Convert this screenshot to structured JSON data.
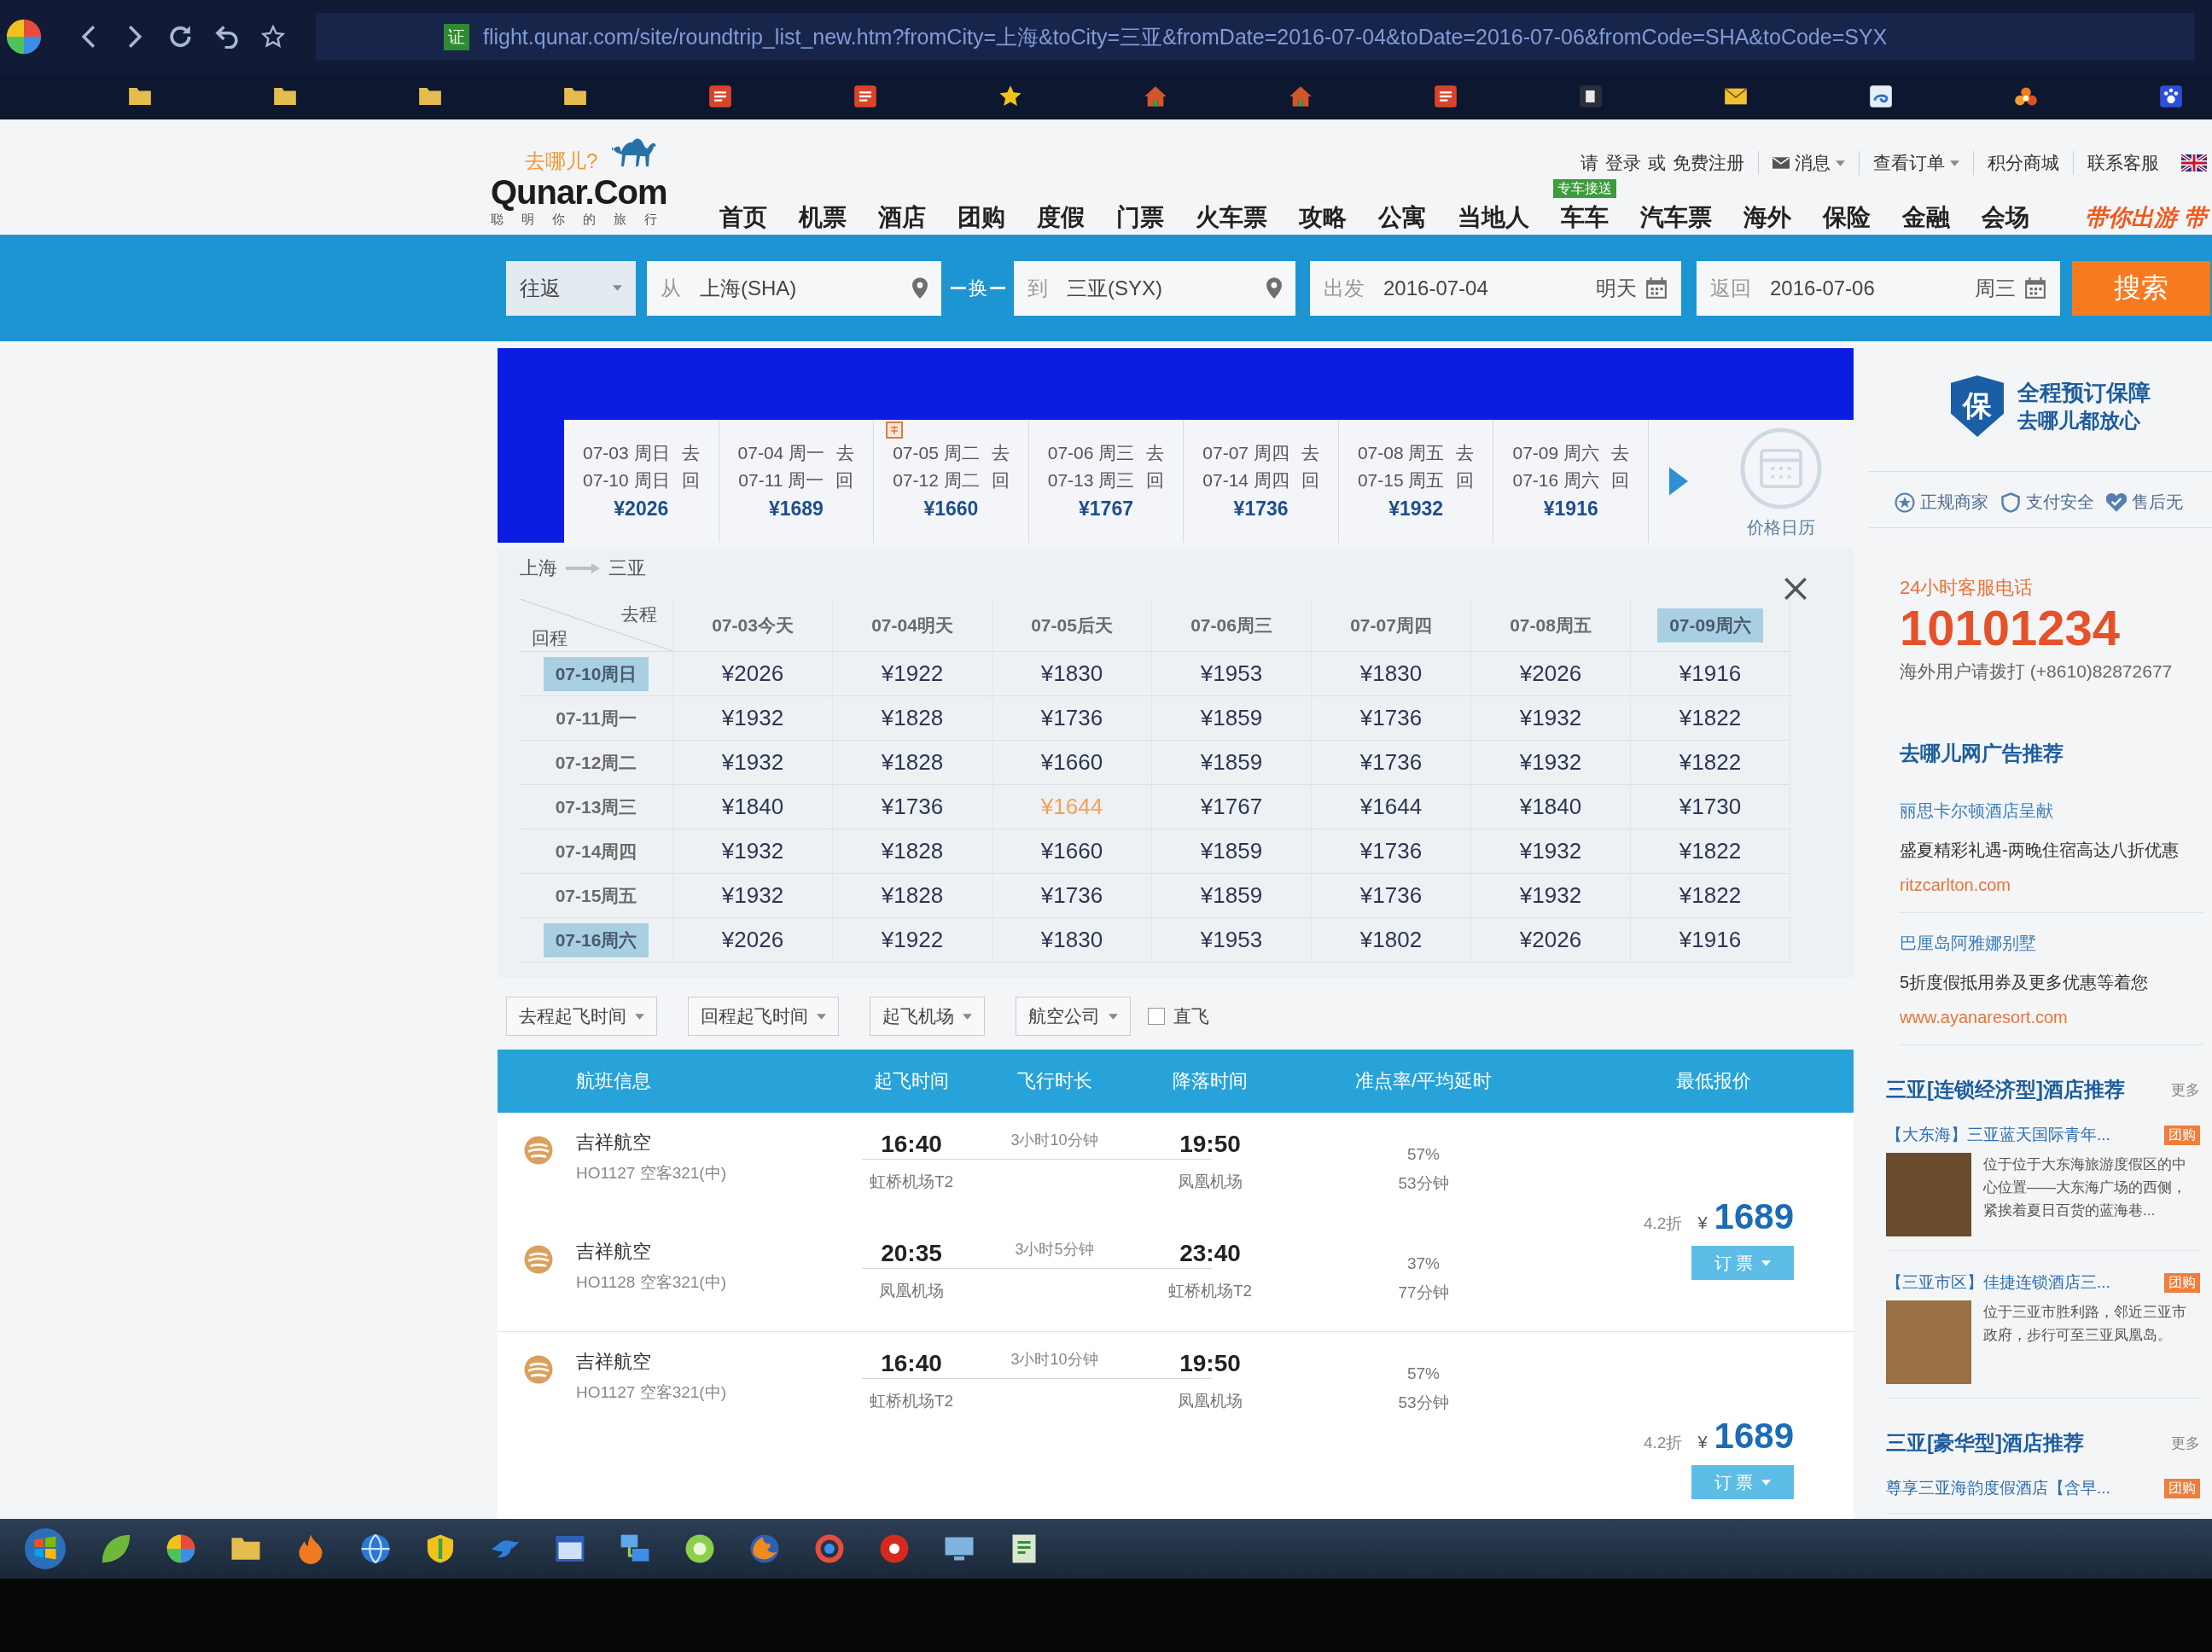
{
  "browser": {
    "cert_badge": "证",
    "url": "flight.qunar.com/site/roundtrip_list_new.htm?fromCity=上海&toCity=三亚&fromDate=2016-07-04&toDate=2016-07-06&fromCode=SHA&toCode=SYX"
  },
  "header": {
    "logo": {
      "kicker": "去哪儿?",
      "wordmark": "Qunar.Com",
      "tagline": "聪明你的旅行"
    },
    "account": {
      "prompt": "请",
      "login": "登录",
      "joiner": "或",
      "register": "免费注册"
    },
    "top_menu": [
      {
        "label": "消息",
        "kind": "messages",
        "dropdown": true
      },
      {
        "label": "查看订单",
        "kind": "orders",
        "dropdown": true
      },
      {
        "label": "积分商城",
        "kind": "mall",
        "dropdown": false
      },
      {
        "label": "联系客服",
        "kind": "service",
        "dropdown": false
      }
    ],
    "nav": [
      {
        "label": "首页"
      },
      {
        "label": "机票"
      },
      {
        "label": "酒店"
      },
      {
        "label": "团购"
      },
      {
        "label": "度假"
      },
      {
        "label": "门票"
      },
      {
        "label": "火车票"
      },
      {
        "label": "攻略"
      },
      {
        "label": "公寓"
      },
      {
        "label": "当地人"
      },
      {
        "label": "车车",
        "badge": "专车接送"
      },
      {
        "label": "汽车票"
      },
      {
        "label": "海外"
      },
      {
        "label": "保险"
      },
      {
        "label": "金融"
      },
      {
        "label": "会场"
      }
    ],
    "slogan": "带你出游 带"
  },
  "search": {
    "trip_type": "往返",
    "from": {
      "label": "从",
      "value": "上海(SHA)"
    },
    "swap": "换",
    "to": {
      "label": "到",
      "value": "三亚(SYX)"
    },
    "depart": {
      "label": "出发",
      "value": "2016-07-04",
      "day": "明天"
    },
    "return": {
      "label": "返回",
      "value": "2016-07-06",
      "day": "周三"
    },
    "button": "搜索"
  },
  "date_strip": {
    "items": [
      {
        "depart": "07-03 周日",
        "depart_tag": "去",
        "return": "07-10 周日",
        "return_tag": "回",
        "price": "¥2026",
        "promo": false
      },
      {
        "depart": "07-04 周一",
        "depart_tag": "去",
        "return": "07-11 周一",
        "return_tag": "回",
        "price": "¥1689",
        "promo": false
      },
      {
        "depart": "07-05 周二",
        "depart_tag": "去",
        "return": "07-12 周二",
        "return_tag": "回",
        "price": "¥1660",
        "promo": true
      },
      {
        "depart": "07-06 周三",
        "depart_tag": "去",
        "return": "07-13 周三",
        "return_tag": "回",
        "price": "¥1767",
        "promo": false
      },
      {
        "depart": "07-07 周四",
        "depart_tag": "去",
        "return": "07-14 周四",
        "return_tag": "回",
        "price": "¥1736",
        "promo": false
      },
      {
        "depart": "07-08 周五",
        "depart_tag": "去",
        "return": "07-15 周五",
        "return_tag": "回",
        "price": "¥1932",
        "promo": false
      },
      {
        "depart": "07-09 周六",
        "depart_tag": "去",
        "return": "07-16 周六",
        "return_tag": "回",
        "price": "¥1916",
        "promo": false
      }
    ],
    "calendar_label": "价格日历"
  },
  "matrix": {
    "origin": "上海",
    "destination": "三亚",
    "corner_depart": "去程",
    "corner_return": "回程",
    "columns": [
      {
        "label": "07-03今天",
        "selected": false
      },
      {
        "label": "07-04明天",
        "selected": false
      },
      {
        "label": "07-05后天",
        "selected": false
      },
      {
        "label": "07-06周三",
        "selected": false
      },
      {
        "label": "07-07周四",
        "selected": false
      },
      {
        "label": "07-08周五",
        "selected": false
      },
      {
        "label": "07-09周六",
        "selected": true
      }
    ],
    "rows": [
      {
        "label": "07-10周日",
        "selected": true,
        "cells": [
          {
            "price": "¥2026",
            "highlighted": false
          },
          {
            "price": "¥1922",
            "highlighted": false
          },
          {
            "price": "¥1830",
            "highlighted": false
          },
          {
            "price": "¥1953",
            "highlighted": false
          },
          {
            "price": "¥1830",
            "highlighted": false
          },
          {
            "price": "¥2026",
            "highlighted": false
          },
          {
            "price": "¥1916",
            "highlighted": false
          }
        ]
      },
      {
        "label": "07-11周一",
        "selected": false,
        "cells": [
          {
            "price": "¥1932",
            "highlighted": false
          },
          {
            "price": "¥1828",
            "highlighted": false
          },
          {
            "price": "¥1736",
            "highlighted": false
          },
          {
            "price": "¥1859",
            "highlighted": false
          },
          {
            "price": "¥1736",
            "highlighted": false
          },
          {
            "price": "¥1932",
            "highlighted": false
          },
          {
            "price": "¥1822",
            "highlighted": false
          }
        ]
      },
      {
        "label": "07-12周二",
        "selected": false,
        "cells": [
          {
            "price": "¥1932",
            "highlighted": false
          },
          {
            "price": "¥1828",
            "highlighted": false
          },
          {
            "price": "¥1660",
            "highlighted": false
          },
          {
            "price": "¥1859",
            "highlighted": false
          },
          {
            "price": "¥1736",
            "highlighted": false
          },
          {
            "price": "¥1932",
            "highlighted": false
          },
          {
            "price": "¥1822",
            "highlighted": false
          }
        ]
      },
      {
        "label": "07-13周三",
        "selected": false,
        "cells": [
          {
            "price": "¥1840",
            "highlighted": false
          },
          {
            "price": "¥1736",
            "highlighted": false
          },
          {
            "price": "¥1644",
            "highlighted": true
          },
          {
            "price": "¥1767",
            "highlighted": false
          },
          {
            "price": "¥1644",
            "highlighted": false
          },
          {
            "price": "¥1840",
            "highlighted": false
          },
          {
            "price": "¥1730",
            "highlighted": false
          }
        ]
      },
      {
        "label": "07-14周四",
        "selected": false,
        "cells": [
          {
            "price": "¥1932",
            "highlighted": false
          },
          {
            "price": "¥1828",
            "highlighted": false
          },
          {
            "price": "¥1660",
            "highlighted": false
          },
          {
            "price": "¥1859",
            "highlighted": false
          },
          {
            "price": "¥1736",
            "highlighted": false
          },
          {
            "price": "¥1932",
            "highlighted": false
          },
          {
            "price": "¥1822",
            "highlighted": false
          }
        ]
      },
      {
        "label": "07-15周五",
        "selected": false,
        "cells": [
          {
            "price": "¥1932",
            "highlighted": false
          },
          {
            "price": "¥1828",
            "highlighted": false
          },
          {
            "price": "¥1736",
            "highlighted": false
          },
          {
            "price": "¥1859",
            "highlighted": false
          },
          {
            "price": "¥1736",
            "highlighted": false
          },
          {
            "price": "¥1932",
            "highlighted": false
          },
          {
            "price": "¥1822",
            "highlighted": false
          }
        ]
      },
      {
        "label": "07-16周六",
        "selected": true,
        "cells": [
          {
            "price": "¥2026",
            "highlighted": false
          },
          {
            "price": "¥1922",
            "highlighted": false
          },
          {
            "price": "¥1830",
            "highlighted": false
          },
          {
            "price": "¥1953",
            "highlighted": false
          },
          {
            "price": "¥1802",
            "highlighted": false
          },
          {
            "price": "¥2026",
            "highlighted": false
          },
          {
            "price": "¥1916",
            "highlighted": false
          }
        ]
      }
    ]
  },
  "filters": {
    "dropdowns": [
      "去程起飞时间",
      "回程起飞时间",
      "起飞机场",
      "航空公司"
    ],
    "nonstop": {
      "label": "直飞",
      "checked": false
    }
  },
  "flights": {
    "columns": [
      "航班信息",
      "起飞时间",
      "飞行时长",
      "降落时间",
      "准点率/平均延时",
      "最低报价"
    ],
    "groups": [
      {
        "legs": [
          {
            "airline": "吉祥航空",
            "flight": "HO1127 空客321(中)",
            "dep_time": "16:40",
            "duration": "3小时10分钟",
            "arr_time": "19:50",
            "dep_airport": "虹桥机场T2",
            "arr_airport": "凤凰机场",
            "ontime": "57%",
            "delay": "53分钟"
          },
          {
            "airline": "吉祥航空",
            "flight": "HO1128 空客321(中)",
            "dep_time": "20:35",
            "duration": "3小时5分钟",
            "arr_time": "23:40",
            "dep_airport": "凤凰机场",
            "arr_airport": "虹桥机场T2",
            "ontime": "37%",
            "delay": "77分钟"
          }
        ],
        "discount": "4.2折",
        "currency": "¥",
        "price": "1689",
        "book": "订 票"
      },
      {
        "legs": [
          {
            "airline": "吉祥航空",
            "flight": "HO1127 空客321(中)",
            "dep_time": "16:40",
            "duration": "3小时10分钟",
            "arr_time": "19:50",
            "dep_airport": "虹桥机场T2",
            "arr_airport": "凤凰机场",
            "ontime": "57%",
            "delay": "53分钟"
          }
        ],
        "discount": "4.2折",
        "currency": "¥",
        "price": "1689",
        "book": "订 票"
      }
    ]
  },
  "sidebar": {
    "guarantee": {
      "mark": "保",
      "title": "全程预订保障",
      "subtitle": "去哪儿都放心"
    },
    "trust": [
      {
        "label": "正规商家"
      },
      {
        "label": "支付安全"
      },
      {
        "label": "售后无"
      }
    ],
    "hotline": {
      "label": "24小时客服电话",
      "number": "10101234",
      "overseas": "海外用户请拨打 (+8610)82872677"
    },
    "ads": {
      "title": "去哪儿网广告推荐",
      "items": [
        {
          "title": "丽思卡尔顿酒店呈献",
          "text": "盛夏精彩礼遇-两晚住宿高达八折优惠",
          "url": "ritzcarlton.com"
        },
        {
          "title": "巴厘岛阿雅娜别墅",
          "text": "5折度假抵用券及更多优惠等着您",
          "url": "www.ayanaresort.com"
        }
      ]
    },
    "hotel_sections": [
      {
        "title": "三亚[连锁经济型]酒店推荐",
        "more": "更多",
        "items": [
          {
            "name": "【大东海】三亚蓝天国际青年...",
            "badge": "团购",
            "description": "位于位于大东海旅游度假区的中心位置——大东海广场的西侧，紧挨着夏日百货的蓝海巷..."
          },
          {
            "name": "【三亚市区】佳捷连锁酒店三...",
            "badge": "团购",
            "description": "位于三亚市胜利路，邻近三亚市政府，步行可至三亚凤凰岛。"
          }
        ]
      },
      {
        "title": "三亚[豪华型]酒店推荐",
        "more": "更多",
        "items": [
          {
            "name": "尊享三亚海韵度假酒店【含早...",
            "badge": "团购"
          }
        ]
      }
    ]
  }
}
